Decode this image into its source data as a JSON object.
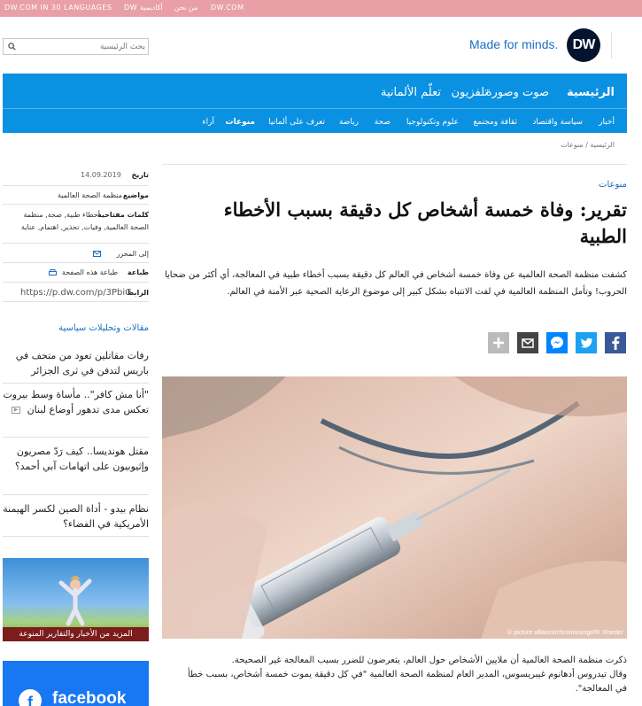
{
  "topbar": {
    "links": [
      "DW.COM IN 30 LANGUAGES",
      "DW أكاديمية",
      "من نحن",
      "DW.COM"
    ]
  },
  "search": {
    "placeholder": "بحث الرئيسية",
    "icon": "search-icon"
  },
  "brand": {
    "tagline": "Made for minds.",
    "logo": "DW"
  },
  "nav": {
    "main": [
      "الرئيسية",
      "صوت وصورة",
      "تلفزيون",
      "تعلّم الألمانية"
    ],
    "sub": [
      "أخبار",
      "سياسة واقتصاد",
      "ثقافة ومجتمع",
      "علوم وتكنولوجيا",
      "صحة",
      "رياضة",
      "تعرف على ألمانيا",
      "منوعات",
      "آراء"
    ]
  },
  "breadcrumb": "الرئيسية / منوعات",
  "sidebar": {
    "date_label": "تاريخ",
    "date_value": "14.09.2019",
    "topics_label": "مواضيع",
    "topics_value": "منظمة الصحة العالمية",
    "keywords_label": "كلمات مفتاحية",
    "keywords_line1": "أخطاء طبية, صحة, منظمة",
    "keywords_line2": "الصحة العالمية, وفيات, تحذير, اهتمام, عناية",
    "editor_link": "إلى المحرر",
    "print_label": "طباعة",
    "print_link": "طباعة هذه الصفحة",
    "permalink_label": "الرابط",
    "permalink_value": "https://p.dw.com/p/3PbiG"
  },
  "related": {
    "title": "مقالات وتحليلات سياسية",
    "stories": [
      "رفات مقاتلين تعود من متحف في باريس لتدفن في ثرى الجزائر",
      "\"أنا مش كافر\".. مأساة وسط بيروت تعكس مدى تدهور أوضاع لبنان",
      "مقتل هونديسا.. كيف رَدّ مصريون وإثيوبيون على اتهامات آبي أحمد؟",
      "نظام بيدو - أداة الصين لكسر الهيمنة الأمريكية في الفضاء؟"
    ]
  },
  "promo": {
    "caption": "المزيد من الأخبار والتقارير المنوعة"
  },
  "facebook": {
    "label": "facebook",
    "glyph": "f"
  },
  "article": {
    "kicker": "منوعات",
    "headline": "تقرير: وفاة خمسة أشخاص كل دقيقة بسبب الأخطاء الطبية",
    "lead": "كشفت منظمة الصحة العالمية عن وفاة خمسة أشخاص في العالم كل دقيقة بسبب أخطاء طبية في المعالجة، أي أكثر من ضحايا الحروب! وتأمل المنظمة العالمية في لفت الانتباه بشكل كبير إلى موضوع الرعاية الصحية عبر الأمنة في العالم.",
    "share_icons": [
      "facebook-icon",
      "twitter-icon",
      "messenger-icon",
      "mail-icon",
      "plus-icon"
    ],
    "image_credit": "© picture alliance/chromorange/R. Roeder",
    "body_line1": "ذكرت منظمة الصحة العالمية أن ملايين الأشخاص حول العالم، يتعرضون للضرر بسبب المعالجة غير الصحيحة.",
    "body_line2": "وقال تيدروس أدهانوم غيبريسوس، المدير العام لمنظمة الصحة العالمية \"في كل دقيقة يموت خمسة أشخاص، بسبب خطأ في المعالجة\"."
  },
  "colors": {
    "topbar": "#e8a0a6",
    "nav": "#0a91e1",
    "link": "#1b6fc1",
    "facebook": "#1877f2"
  }
}
